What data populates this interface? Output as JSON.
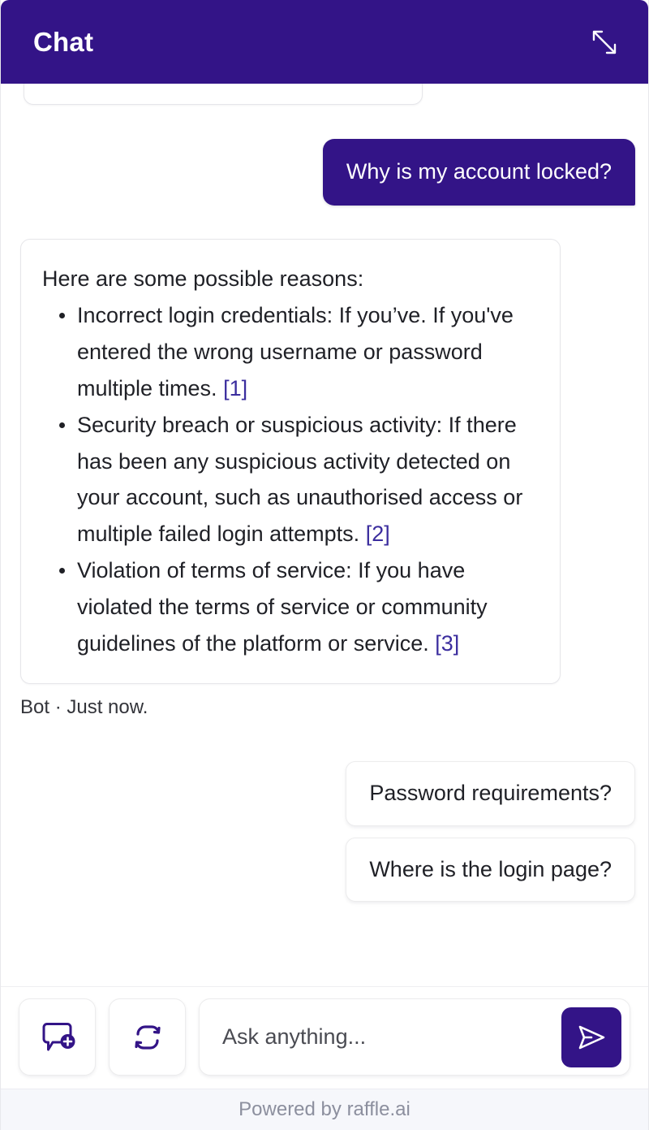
{
  "header": {
    "title": "Chat",
    "expand_icon": "expand-diagonal-icon",
    "background_color": "#331487"
  },
  "messages": [
    {
      "role": "user",
      "text": "Why is my account locked?"
    },
    {
      "role": "bot",
      "intro": "Here are some possible reasons:",
      "bullets": [
        {
          "text": "Incorrect login credentials: If you’ve. If you've entered the wrong username or password multiple times. ",
          "citation": "[1]"
        },
        {
          "text": "Security breach or suspicious activity: If there has been any suspicious activity detected on your account, such as unauthorised access or multiple failed login attempts. ",
          "citation": "[2]"
        },
        {
          "text": "Violation of terms of service: If you have violated the terms of service or community guidelines of the platform or service. ",
          "citation": "[3]"
        }
      ],
      "meta": "Bot · Just now."
    }
  ],
  "suggestions": [
    {
      "label": "Password requirements?"
    },
    {
      "label": "Where is the login page?"
    }
  ],
  "toolbar": {
    "new_chat_icon": "chat-bubble-plus-icon",
    "reset_icon": "refresh-circular-arrows-icon",
    "send_icon": "send-paper-plane-icon"
  },
  "composer": {
    "placeholder": "Ask anything...",
    "value": ""
  },
  "footer": {
    "text": "Powered by raffle.ai"
  },
  "colors": {
    "brand_purple": "#331487",
    "citation_link": "#3b2d9e",
    "text_primary": "#1f2026",
    "footer_text": "#8c8f9e",
    "footer_background": "#f6f7fb",
    "border": "#e6e6ea"
  }
}
